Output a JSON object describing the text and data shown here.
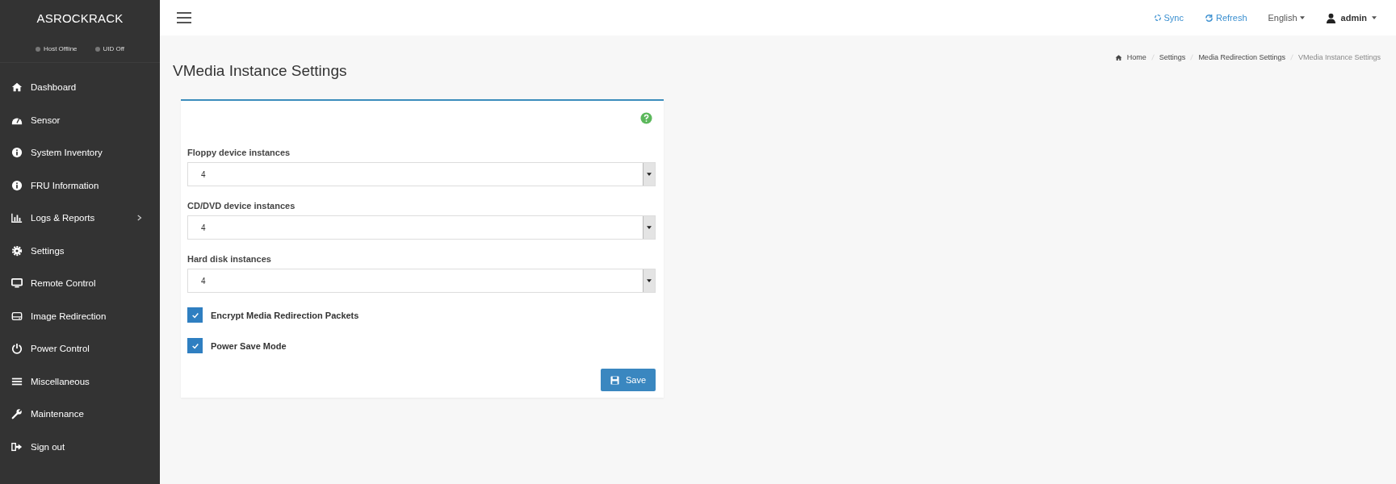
{
  "sidebar": {
    "logo": "ASROCKRACK",
    "status": [
      {
        "label": "Host Offline"
      },
      {
        "label": "UID Off"
      }
    ],
    "items": [
      {
        "label": "Dashboard",
        "expandable": false
      },
      {
        "label": "Sensor",
        "expandable": false
      },
      {
        "label": "System Inventory",
        "expandable": false
      },
      {
        "label": "FRU Information",
        "expandable": false
      },
      {
        "label": "Logs & Reports",
        "expandable": true
      },
      {
        "label": "Settings",
        "expandable": false
      },
      {
        "label": "Remote Control",
        "expandable": false
      },
      {
        "label": "Image Redirection",
        "expandable": false
      },
      {
        "label": "Power Control",
        "expandable": false
      },
      {
        "label": "Miscellaneous",
        "expandable": false
      },
      {
        "label": "Maintenance",
        "expandable": false
      },
      {
        "label": "Sign out",
        "expandable": false
      }
    ]
  },
  "topbar": {
    "sync": "Sync",
    "refresh": "Refresh",
    "language": "English",
    "user": "admin"
  },
  "breadcrumb": [
    {
      "label": "Home",
      "current": false
    },
    {
      "label": "Settings",
      "current": false
    },
    {
      "label": "Media Redirection Settings",
      "current": false
    },
    {
      "label": "VMedia Instance Settings",
      "current": true
    }
  ],
  "page_title": "VMedia Instance Settings",
  "form": {
    "fields": [
      {
        "label": "Floppy device instances",
        "value": "4"
      },
      {
        "label": "CD/DVD device instances",
        "value": "4"
      },
      {
        "label": "Hard disk instances",
        "value": "4"
      }
    ],
    "checkboxes": [
      {
        "label": "Encrypt Media Redirection Packets",
        "checked": true
      },
      {
        "label": "Power Save Mode",
        "checked": true
      }
    ],
    "save": "Save"
  }
}
